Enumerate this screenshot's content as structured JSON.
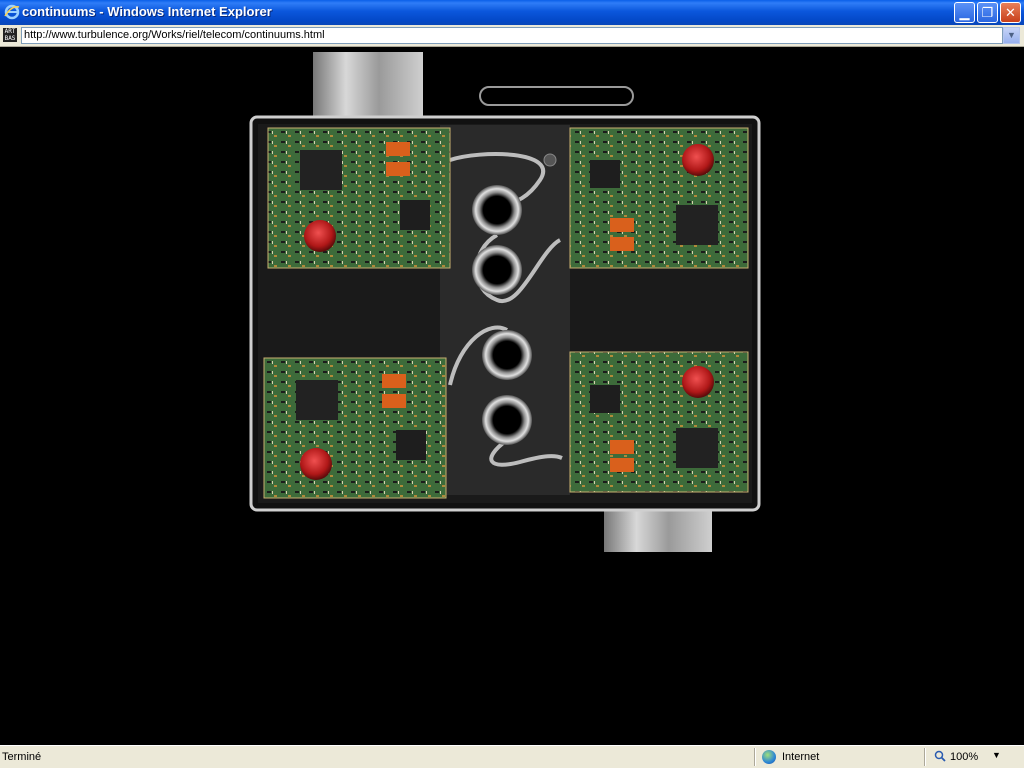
{
  "window": {
    "title": "continuums - Windows Internet Explorer"
  },
  "address": {
    "url": "http://www.turbulence.org/Works/riel/telecom/continuums.html",
    "site_icon_text": "ART BAS"
  },
  "controls": {
    "minimize": "minimize-icon",
    "restore": "restore-icon",
    "close": "close-icon"
  },
  "status": {
    "text": "Terminé",
    "zone": "Internet",
    "zoom": "100%"
  },
  "colors": {
    "titlebar": "#0b57dc",
    "chrome": "#ece9d8",
    "page_bg": "#000000",
    "pcb": "#3a6e3a",
    "button_red": "#c81e1e"
  }
}
